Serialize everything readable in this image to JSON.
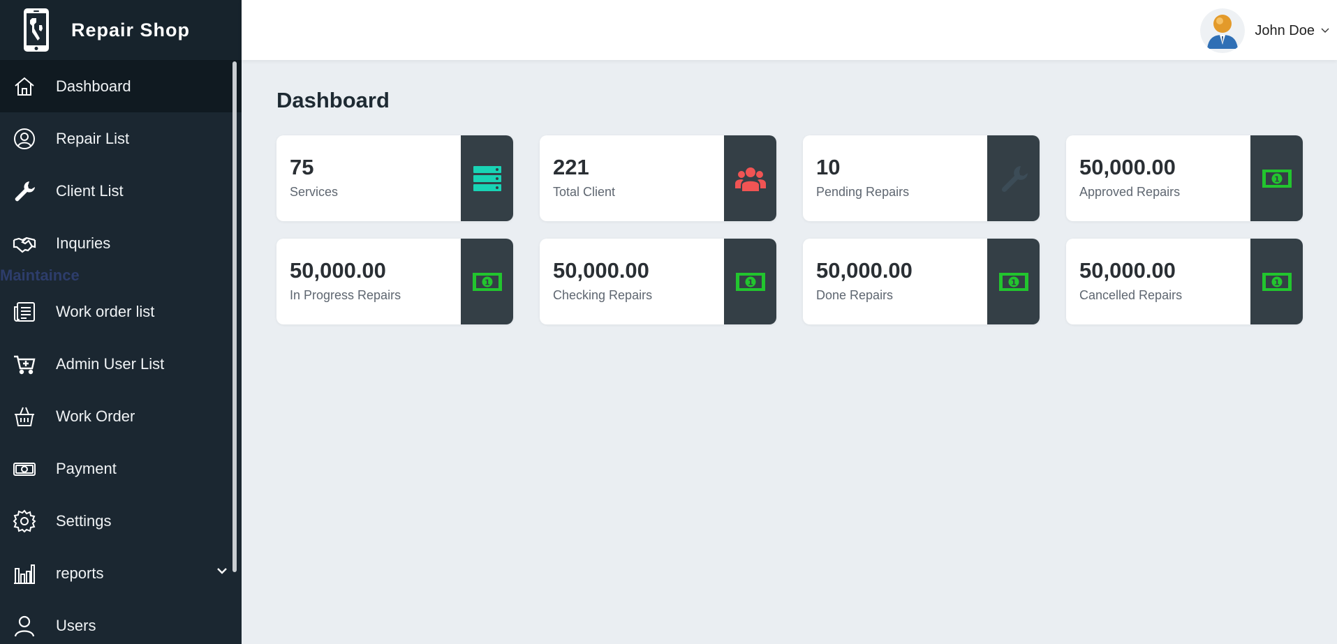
{
  "app": {
    "title": "Repair Shop"
  },
  "sidebar": {
    "items": [
      {
        "label": "Dashboard",
        "icon": "home-icon"
      },
      {
        "label": "Repair List",
        "icon": "user-circle-icon"
      },
      {
        "label": "Client List",
        "icon": "wrench-icon"
      },
      {
        "label": "Inquries",
        "icon": "handshake-icon"
      }
    ],
    "section_label": "Maintaince",
    "items2": [
      {
        "label": "Work order list",
        "icon": "document-list-icon"
      },
      {
        "label": "Admin User List",
        "icon": "cart-plus-icon"
      },
      {
        "label": "Work Order",
        "icon": "basket-icon"
      },
      {
        "label": "Payment",
        "icon": "money-icon"
      },
      {
        "label": "Settings",
        "icon": "gear-icon"
      },
      {
        "label": "reports",
        "icon": "bar-chart-icon"
      },
      {
        "label": "Users",
        "icon": "user-icon"
      }
    ]
  },
  "header": {
    "user_name": "John Doe"
  },
  "main": {
    "title": "Dashboard",
    "cards": [
      {
        "value": "75",
        "label": "Services",
        "icon": "server-icon",
        "icon_color": "#19d3b5"
      },
      {
        "value": "221",
        "label": "Total Client",
        "icon": "users-icon",
        "icon_color": "#f05454"
      },
      {
        "value": "10",
        "label": "Pending Repairs",
        "icon": "wrench-icon",
        "icon_color": "#3c4c57"
      },
      {
        "value": "50,000.00",
        "label": "Approved Repairs",
        "icon": "money-bill-icon",
        "icon_color": "#22c52e"
      },
      {
        "value": "50,000.00",
        "label": "In Progress Repairs",
        "icon": "money-bill-icon",
        "icon_color": "#22c52e"
      },
      {
        "value": "50,000.00",
        "label": "Checking Repairs",
        "icon": "money-bill-icon",
        "icon_color": "#22c52e"
      },
      {
        "value": "50,000.00",
        "label": "Done Repairs",
        "icon": "money-bill-icon",
        "icon_color": "#22c52e"
      },
      {
        "value": "50,000.00",
        "label": "Cancelled Repairs",
        "icon": "money-bill-icon",
        "icon_color": "#22c52e"
      }
    ]
  }
}
